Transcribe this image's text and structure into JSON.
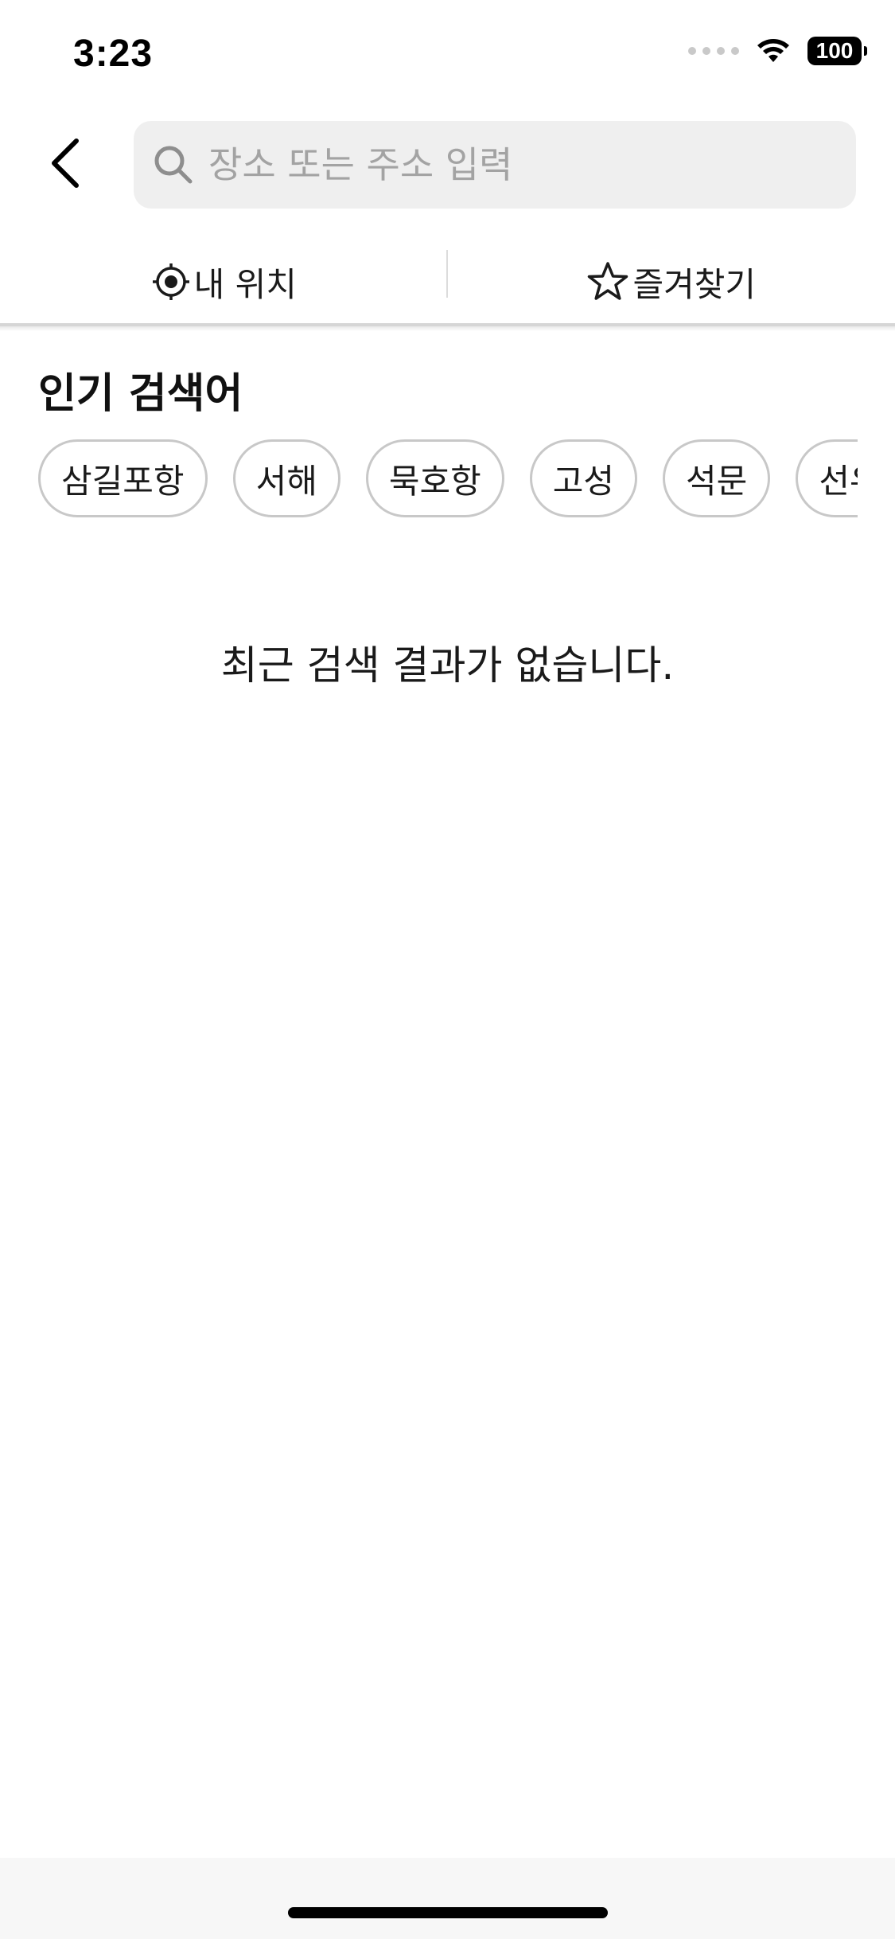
{
  "status_bar": {
    "time": "3:23",
    "battery": "100"
  },
  "search": {
    "placeholder": "장소 또는 주소 입력",
    "value": ""
  },
  "quick_actions": {
    "my_location_label": "내 위치",
    "favorites_label": "즐겨찾기"
  },
  "popular": {
    "title": "인기 검색어",
    "items": [
      "삼길포항",
      "서해",
      "묵호항",
      "고성",
      "석문",
      "선유도"
    ]
  },
  "recent": {
    "empty_message": "최근 검색 결과가 없습니다."
  }
}
